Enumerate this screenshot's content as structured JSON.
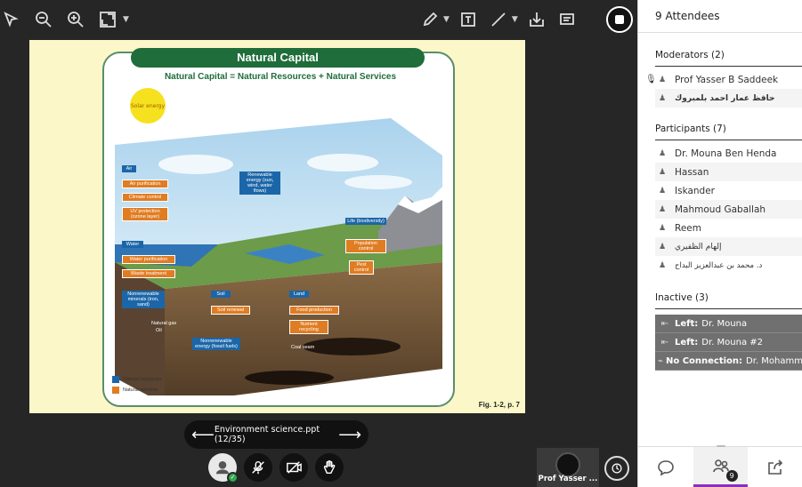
{
  "slide": {
    "title": "Natural Capital",
    "subtitle": "Natural Capital = Natural Resources + Natural Services",
    "sun_label": "Solar energy",
    "labels_blue": [
      "Air",
      "Renewable energy (sun, wind, water flows)",
      "Life (biodiversity)",
      "Water",
      "Nonrenewable minerals (iron, sand)",
      "Soil",
      "Land",
      "Nonrenewable energy (fossil fuels)"
    ],
    "labels_orange": [
      "Air purification",
      "Climate control",
      "UV protection (ozone layer)",
      "Population control",
      "Pest control",
      "Water purification",
      "Waste treatment",
      "Soil renewal",
      "Food production",
      "Nutrient recycling"
    ],
    "ground_labels": [
      "Natural gas",
      "Oil",
      "Coal seam"
    ],
    "legend": [
      "Natural resources",
      "Natural services"
    ],
    "fig_ref": "Fig. 1-2, p. 7"
  },
  "slide_nav": {
    "filename": "Environment science.ppt",
    "position": "(12/35)"
  },
  "presenter": {
    "name": "Prof Yasser ..."
  },
  "panel": {
    "title": "9 Attendees",
    "moderators_title": "Moderators (2)",
    "moderators": [
      "Prof Yasser B Saddeek",
      "حافظ عمار احمد بلمبروك"
    ],
    "participants_title": "Participants (7)",
    "participants": [
      "Dr. Mouna Ben Henda",
      "Hassan",
      "Iskander",
      "Mahmoud Gaballah",
      "Reem",
      "إلهام الظفيري",
      "د. محمد بن عبدالعزيز البداح"
    ],
    "inactive_title": "Inactive (3)",
    "inactive": [
      {
        "status": "Left:",
        "name": "Dr. Mouna"
      },
      {
        "status": "Left:",
        "name": "Dr. Mouna #2"
      },
      {
        "status": "No Connection:",
        "name": "Dr. Mohamm"
      }
    ],
    "badge_count": "9"
  },
  "colors": {
    "slide_bg": "#fbf7c8",
    "title_green": "#1f6d3a",
    "resource_blue": "#1b66a8",
    "service_orange": "#e07c22",
    "active_tab": "#8a2fb8"
  }
}
